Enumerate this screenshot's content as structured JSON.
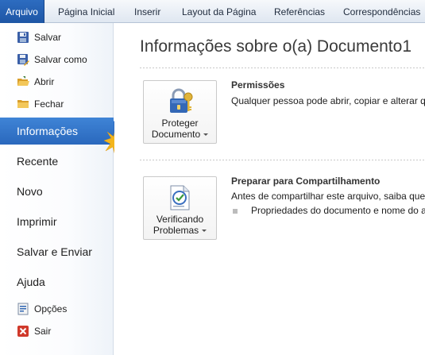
{
  "ribbon": {
    "tabs": [
      {
        "label": "Arquivo",
        "active": true
      },
      {
        "label": "Página Inicial"
      },
      {
        "label": "Inserir"
      },
      {
        "label": "Layout da Página"
      },
      {
        "label": "Referências"
      },
      {
        "label": "Correspondências"
      }
    ],
    "file_tab_color": "#2a64b5"
  },
  "backstage_nav": {
    "top_items": [
      {
        "label": "Salvar",
        "icon": "save-icon"
      },
      {
        "label": "Salvar como",
        "icon": "save-as-icon"
      },
      {
        "label": "Abrir",
        "icon": "open-folder-icon"
      },
      {
        "label": "Fechar",
        "icon": "close-folder-icon"
      }
    ],
    "main_items": [
      {
        "label": "Informações",
        "active": true
      },
      {
        "label": "Recente"
      },
      {
        "label": "Novo"
      },
      {
        "label": "Imprimir"
      },
      {
        "label": "Salvar e Enviar"
      },
      {
        "label": "Ajuda"
      }
    ],
    "bottom_items": [
      {
        "label": "Opções",
        "icon": "options-icon"
      },
      {
        "label": "Sair",
        "icon": "exit-icon"
      }
    ],
    "active_color": "#2e6dc2"
  },
  "info_panel": {
    "title": "Informações sobre o(a) Documento1",
    "sections": [
      {
        "button": {
          "line1": "Proteger",
          "line2": "Documento",
          "icon": "lock-keys-icon"
        },
        "title": "Permissões",
        "description": "Qualquer pessoa pode abrir, copiar e alterar qu"
      },
      {
        "button": {
          "line1": "Verificando",
          "line2": "Problemas",
          "icon": "document-check-icon"
        },
        "title": "Preparar para Compartilhamento",
        "description": "Antes de compartilhar este arquivo, saiba que",
        "bullets": [
          "Propriedades do documento e nome do a"
        ]
      }
    ]
  }
}
